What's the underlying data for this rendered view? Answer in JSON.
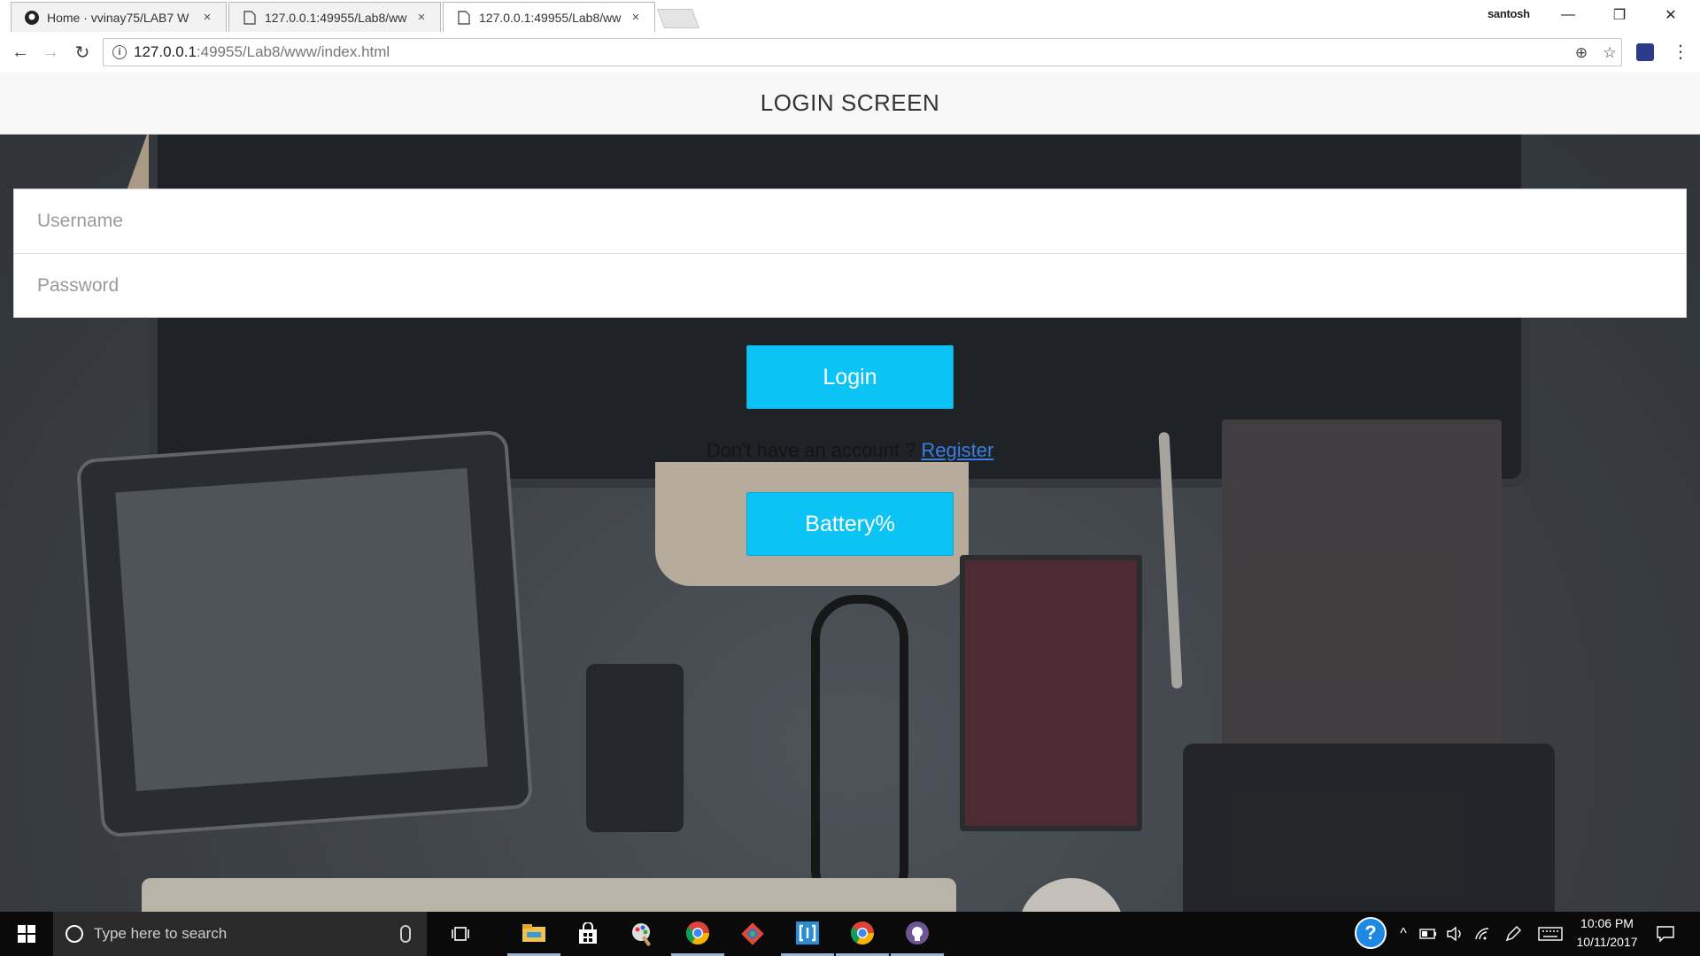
{
  "browser": {
    "tabs": [
      {
        "title": "Home · vvinay75/LAB7 W",
        "icon": "github-icon",
        "active": false
      },
      {
        "title": "127.0.0.1:49955/Lab8/ww",
        "icon": "page-icon",
        "active": false
      },
      {
        "title": "127.0.0.1:49955/Lab8/ww",
        "icon": "page-icon",
        "active": true
      }
    ],
    "close_glyph": "×",
    "profile_name": "santosh",
    "window_controls": {
      "minimize": "—",
      "restore": "❐",
      "close": "✕"
    },
    "nav": {
      "back": "←",
      "forward": "→",
      "reload": "↻"
    },
    "url_host": "127.0.0.1",
    "url_rest": ":49955/Lab8/www/index.html",
    "info_glyph": "i",
    "zoom_glyph": "⊕",
    "star_glyph": "☆",
    "menu_glyph": "⋮"
  },
  "page": {
    "title": "LOGIN SCREEN",
    "username_placeholder": "Username",
    "password_placeholder": "Password",
    "login_label": "Login",
    "register_prompt": "Don't have an account ? ",
    "register_link": "Register",
    "battery_label": "Battery%"
  },
  "taskbar": {
    "search_placeholder": "Type here to search",
    "apps": [
      "task-view-icon",
      "file-explorer-icon",
      "store-icon",
      "paint-icon",
      "chrome-icon",
      "git-icon",
      "brackets-icon",
      "chrome-icon",
      "github-desktop-icon"
    ],
    "clock_time": "10:06 PM",
    "clock_date": "10/11/2017",
    "help_glyph": "?",
    "chevron_glyph": "^"
  },
  "colors": {
    "button": "#0cc3f6",
    "link": "#3b7de0",
    "header_bg": "#f8f8f8"
  }
}
